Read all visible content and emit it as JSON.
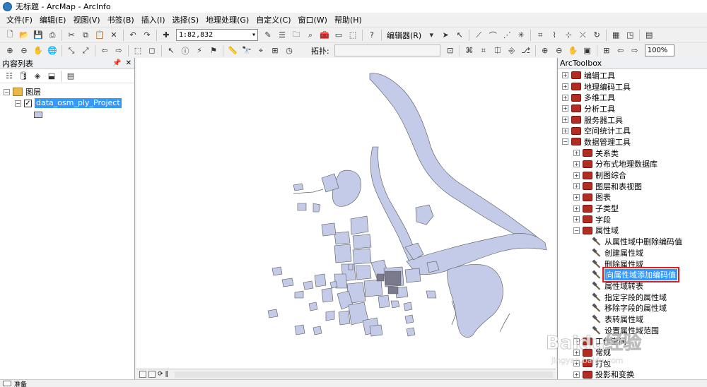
{
  "window": {
    "title": "无标题 - ArcMap - ArcInfo"
  },
  "menu": [
    "文件(F)",
    "编辑(E)",
    "视图(V)",
    "书签(B)",
    "插入(I)",
    "选择(S)",
    "地理处理(G)",
    "自定义(C)",
    "窗口(W)",
    "帮助(H)"
  ],
  "toolbar": {
    "scale_value": "1:82,832",
    "editor_label": "编辑器(R)",
    "topology_label": "拓扑:",
    "zoom_value": "100%"
  },
  "toc": {
    "title": "内容列表",
    "layers_group": "图层",
    "layer_name": "data_osm_ply_Project"
  },
  "toolbox": {
    "title": "ArcToolbox",
    "items": [
      {
        "label": "编辑工具"
      },
      {
        "label": "地理编码工具"
      },
      {
        "label": "多维工具"
      },
      {
        "label": "分析工具"
      },
      {
        "label": "服务器工具"
      },
      {
        "label": "空间统计工具"
      },
      {
        "label": "数据管理工具"
      },
      {
        "label": "关系类"
      },
      {
        "label": "分布式地理数据库"
      },
      {
        "label": "制图综合"
      },
      {
        "label": "图层和表视图"
      },
      {
        "label": "图表"
      },
      {
        "label": "子类型"
      },
      {
        "label": "字段"
      },
      {
        "label": "属性域"
      },
      {
        "label": "从属性域中删除编码值"
      },
      {
        "label": "创建属性域"
      },
      {
        "label": "删除属性域"
      },
      {
        "label": "向属性域添加编码值"
      },
      {
        "label": "属性域转表"
      },
      {
        "label": "指定字段的属性域"
      },
      {
        "label": "移除字段的属性域"
      },
      {
        "label": "表转属性域"
      },
      {
        "label": "设置属性域范围"
      },
      {
        "label": "工作空间"
      },
      {
        "label": "常规"
      },
      {
        "label": "打包"
      },
      {
        "label": "投影和变换"
      }
    ]
  },
  "status": {
    "text": "准备"
  },
  "watermark": {
    "text": "Baidu经验",
    "sub": "jingyan.baidu.com"
  },
  "colors": {
    "map_fill": "#c3cbe8",
    "selection": "#3399ff",
    "highlight_box": "#e02020",
    "toolbox_icon": "#b52b21"
  }
}
